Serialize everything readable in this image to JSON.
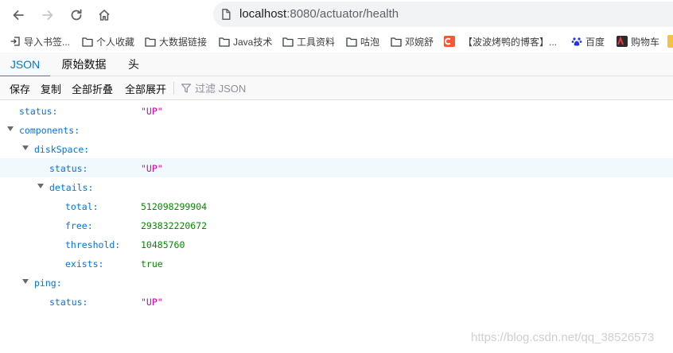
{
  "browser": {
    "url_host": "localhost",
    "url_rest": ":8080/actuator/health"
  },
  "bookmarks": [
    {
      "label": "导入书签...",
      "icon": "import-icon"
    },
    {
      "label": "个人收藏",
      "icon": "folder-icon"
    },
    {
      "label": "大数据链接",
      "icon": "folder-icon"
    },
    {
      "label": "Java技术",
      "icon": "folder-icon"
    },
    {
      "label": "工具资料",
      "icon": "folder-icon"
    },
    {
      "label": "咕泡",
      "icon": "folder-icon"
    },
    {
      "label": "邓婉舒",
      "icon": "folder-icon"
    },
    {
      "label": "【波波烤鸭的博客】...",
      "icon": "csdn-icon"
    },
    {
      "label": "百度",
      "icon": "baidu-icon"
    },
    {
      "label": "购物车",
      "icon": "cart-icon"
    }
  ],
  "viewer": {
    "tabs": [
      "JSON",
      "原始数据",
      "头"
    ],
    "active_tab": "JSON",
    "toolbar": {
      "save": "保存",
      "copy": "复制",
      "collapse_all": "全部折叠",
      "expand_all": "全部展开",
      "filter_placeholder": "过滤 JSON"
    }
  },
  "tree": [
    {
      "key": "status:",
      "value": "\"UP\"",
      "type": "string",
      "depth": 0,
      "twisty": false
    },
    {
      "key": "components:",
      "value": "",
      "type": "object",
      "depth": 0,
      "twisty": true
    },
    {
      "key": "diskSpace:",
      "value": "",
      "type": "object",
      "depth": 1,
      "twisty": true
    },
    {
      "key": "status:",
      "value": "\"UP\"",
      "type": "string",
      "depth": 2,
      "twisty": false,
      "selected": true
    },
    {
      "key": "details:",
      "value": "",
      "type": "object",
      "depth": 2,
      "twisty": true
    },
    {
      "key": "total:",
      "value": "512098299904",
      "type": "number",
      "depth": 3,
      "twisty": false
    },
    {
      "key": "free:",
      "value": "293832220672",
      "type": "number",
      "depth": 3,
      "twisty": false
    },
    {
      "key": "threshold:",
      "value": "10485760",
      "type": "number",
      "depth": 3,
      "twisty": false
    },
    {
      "key": "exists:",
      "value": "true",
      "type": "bool",
      "depth": 3,
      "twisty": false
    },
    {
      "key": "ping:",
      "value": "",
      "type": "object",
      "depth": 1,
      "twisty": true
    },
    {
      "key": "status:",
      "value": "\"UP\"",
      "type": "string",
      "depth": 2,
      "twisty": false
    }
  ],
  "watermark": "https://blog.csdn.net/qq_38526573"
}
